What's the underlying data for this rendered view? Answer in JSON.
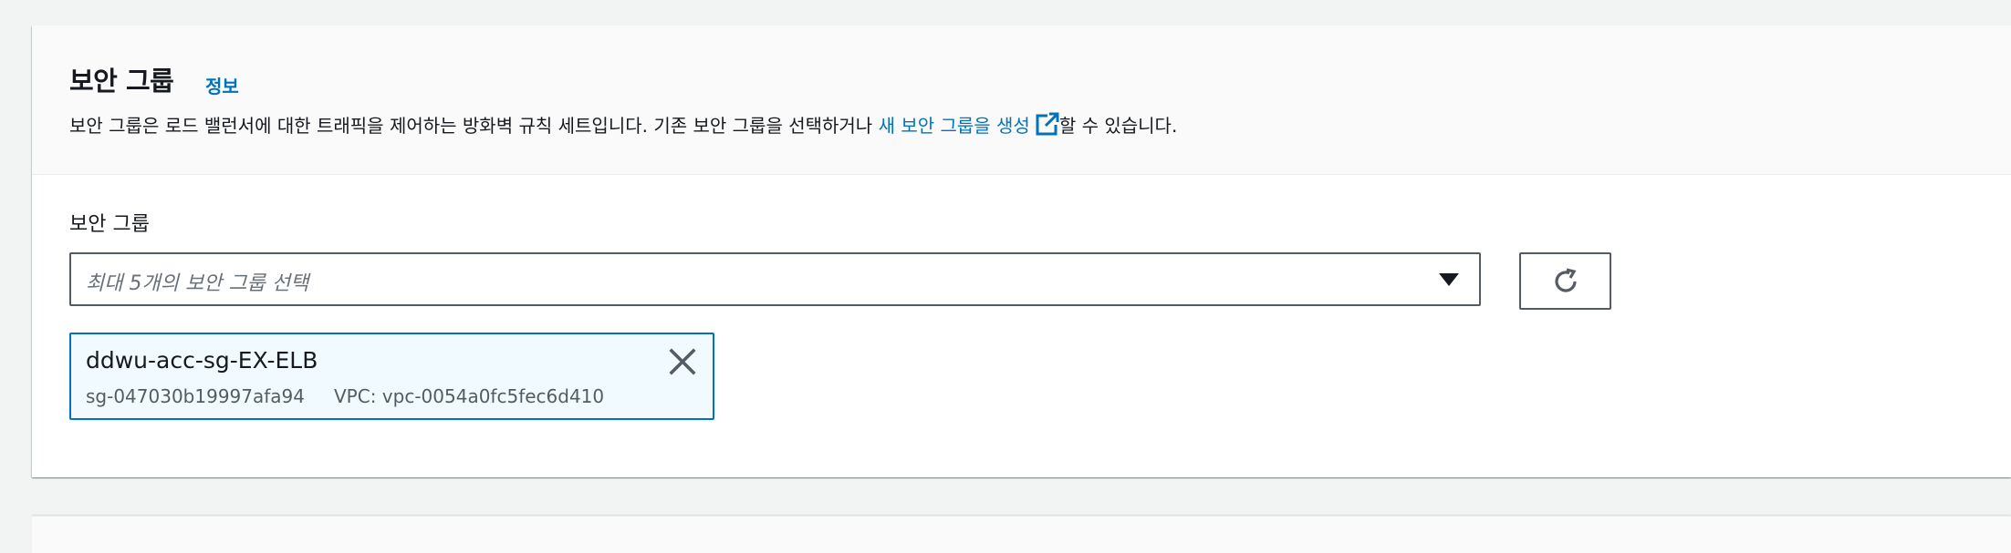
{
  "section": {
    "title": "보안 그룹",
    "info_link": "정보",
    "description_before": "보안 그룹은 로드 밸런서에 대한 트래픽을 제어하는 방화벽 규칙 세트입니다. 기존 보안 그룹을 선택하거나 ",
    "description_link": "새 보안 그룹을 생성",
    "description_after": "할 수 있습니다."
  },
  "field": {
    "label": "보안 그룹",
    "placeholder": "최대 5개의 보안 그룹 선택"
  },
  "selected_groups": [
    {
      "name": "ddwu-acc-sg-EX-ELB",
      "id": "sg-047030b19997afa94",
      "vpc": "VPC: vpc-0054a0fc5fec6d410"
    }
  ],
  "icons": {
    "external": "external-link-icon",
    "caret": "caret-down-icon",
    "refresh": "refresh-icon",
    "close": "close-icon"
  },
  "colors": {
    "link": "#0073bb",
    "token_bg": "#f1faff",
    "token_border": "#0073bb"
  }
}
